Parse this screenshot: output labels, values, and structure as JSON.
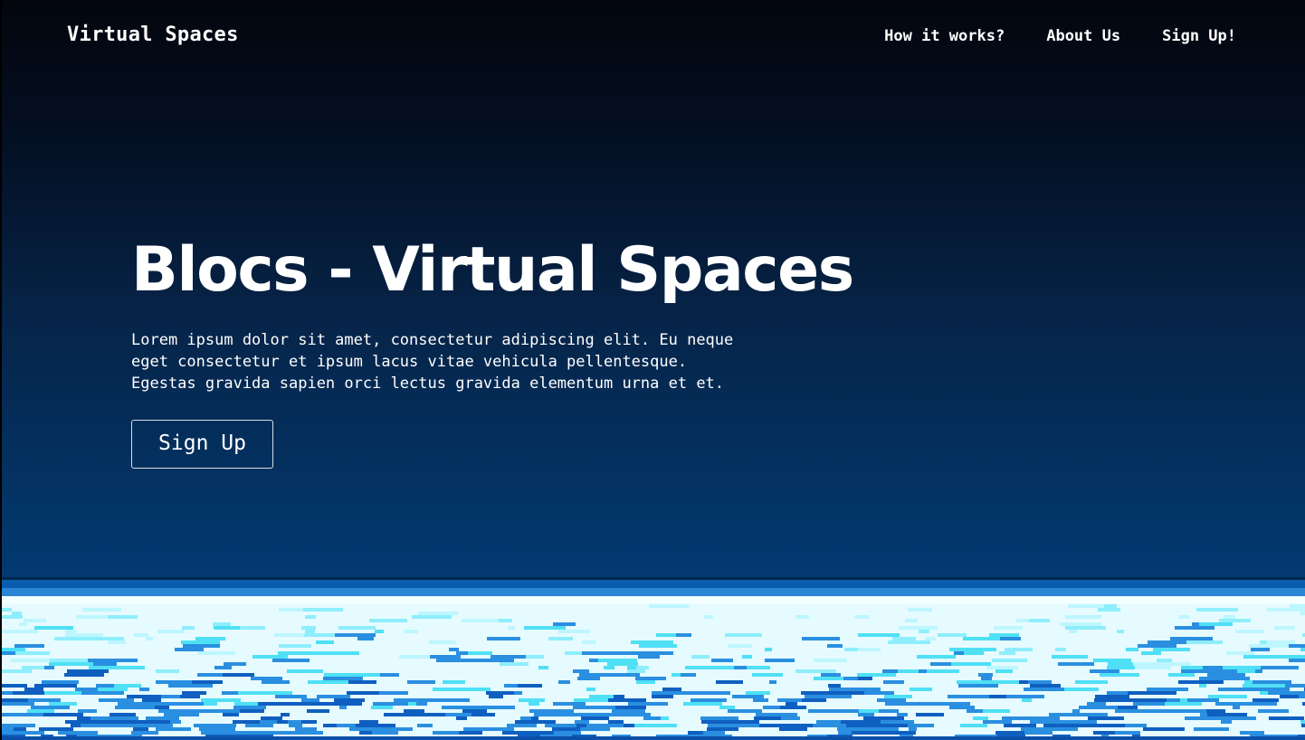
{
  "nav": {
    "brand": "Virtual Spaces",
    "links": [
      {
        "label": "How it works?"
      },
      {
        "label": "About Us"
      },
      {
        "label": "Sign Up!"
      }
    ]
  },
  "hero": {
    "title": "Blocs - Virtual Spaces",
    "text": "Lorem ipsum dolor sit amet, consectetur adipiscing elit. Eu neque\neget consectetur et ipsum lacus vitae vehicula pellentesque.\nEgestas gravida sapien orci lectus gravida elementum urna et et.",
    "button_label": "Sign Up"
  },
  "colors": {
    "gradient_top": "#03060d",
    "gradient_bottom": "#023a72",
    "sea_light": "#e6fbff",
    "sea_cyan": "#4fe0f5",
    "sea_blue": "#2a8fe0",
    "sea_deep": "#0f5fc0"
  }
}
